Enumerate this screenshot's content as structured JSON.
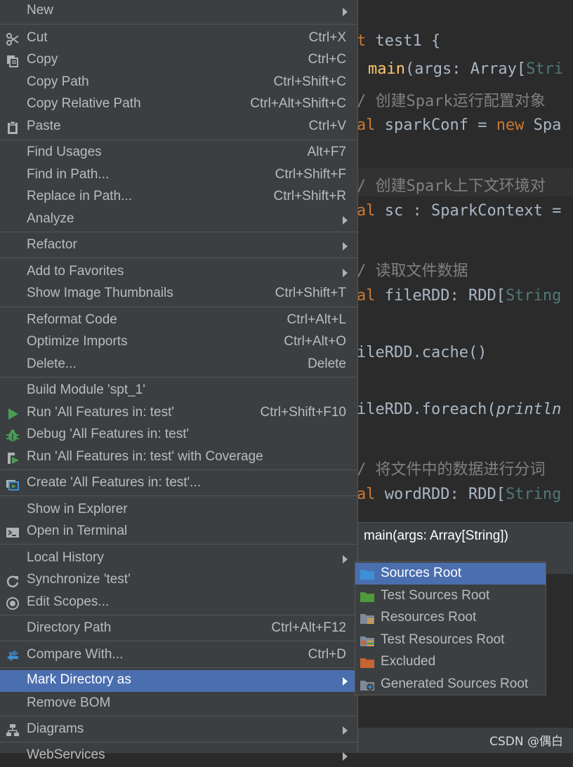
{
  "editor": {
    "line1_kw": "t",
    "line1_rest": " test1 {",
    "line2_fn": "main",
    "line2_rest": "(args: Array[",
    "line2_type": "Stri",
    "line3_comment": "/ 创建Spark运行配置对象",
    "line4_kw": "al",
    "line4_mid": " sparkConf = ",
    "line4_kw2": "new",
    "line4_rest": " Spa",
    "line5_comment": "/ 创建Spark上下文环境对",
    "line6_kw": "al",
    "line6_rest": " sc : SparkContext =",
    "line7_comment": "/ 读取文件数据",
    "line8_kw": "al",
    "line8_rest": " fileRDD: RDD[",
    "line8_type": "String",
    "line9": "ileRDD.cache()",
    "line10_start": "ileRDD.foreach(",
    "line10_italic": "println",
    "line11_comment": "/ 将文件中的数据进行分词",
    "line12_kw": "al",
    "line12_rest": " wordRDD: RDD[",
    "line12_type": "String"
  },
  "breadcrumb": "main(args: Array[String])",
  "watermark": "CSDN @偶白",
  "menu": {
    "new": "New",
    "cut": "Cut",
    "cut_sc": "Ctrl+X",
    "copy": "Copy",
    "copy_sc": "Ctrl+C",
    "copy_path": "Copy Path",
    "copy_path_sc": "Ctrl+Shift+C",
    "copy_rel": "Copy Relative Path",
    "copy_rel_sc": "Ctrl+Alt+Shift+C",
    "paste": "Paste",
    "paste_sc": "Ctrl+V",
    "find_usages": "Find Usages",
    "find_usages_sc": "Alt+F7",
    "find_in_path": "Find in Path...",
    "find_in_path_sc": "Ctrl+Shift+F",
    "replace_in_path": "Replace in Path...",
    "replace_in_path_sc": "Ctrl+Shift+R",
    "analyze": "Analyze",
    "refactor": "Refactor",
    "add_favorites": "Add to Favorites",
    "show_thumbs": "Show Image Thumbnails",
    "show_thumbs_sc": "Ctrl+Shift+T",
    "reformat": "Reformat Code",
    "reformat_sc": "Ctrl+Alt+L",
    "optimize": "Optimize Imports",
    "optimize_sc": "Ctrl+Alt+O",
    "delete": "Delete...",
    "delete_sc": "Delete",
    "build_module": "Build Module 'spt_1'",
    "run": "Run 'All Features in: test'",
    "run_sc": "Ctrl+Shift+F10",
    "debug": "Debug 'All Features in: test'",
    "run_cov": "Run 'All Features in: test' with Coverage",
    "create": "Create 'All Features in: test'...",
    "show_explorer": "Show in Explorer",
    "open_terminal": "Open in Terminal",
    "local_history": "Local History",
    "synchronize": "Synchronize 'test'",
    "edit_scopes": "Edit Scopes...",
    "dir_path": "Directory Path",
    "dir_path_sc": "Ctrl+Alt+F12",
    "compare": "Compare With...",
    "compare_sc": "Ctrl+D",
    "mark_dir": "Mark Directory as",
    "remove_bom": "Remove BOM",
    "diagrams": "Diagrams",
    "webservices": "WebServices"
  },
  "submenu": {
    "items": [
      {
        "label": "Sources Root",
        "color": "#3d8fd6"
      },
      {
        "label": "Test Sources Root",
        "color": "#4e9a3a"
      },
      {
        "label": "Resources Root",
        "color": "#7f8a96"
      },
      {
        "label": "Test Resources Root",
        "color": "#7f8a96"
      },
      {
        "label": "Excluded",
        "color": "#c66433"
      },
      {
        "label": "Generated Sources Root",
        "color": "#3d8fd6"
      }
    ]
  },
  "colors": {
    "menu_bg": "#3c3f41",
    "selection": "#4b6eaf",
    "editor_bg": "#2b2b2b"
  }
}
